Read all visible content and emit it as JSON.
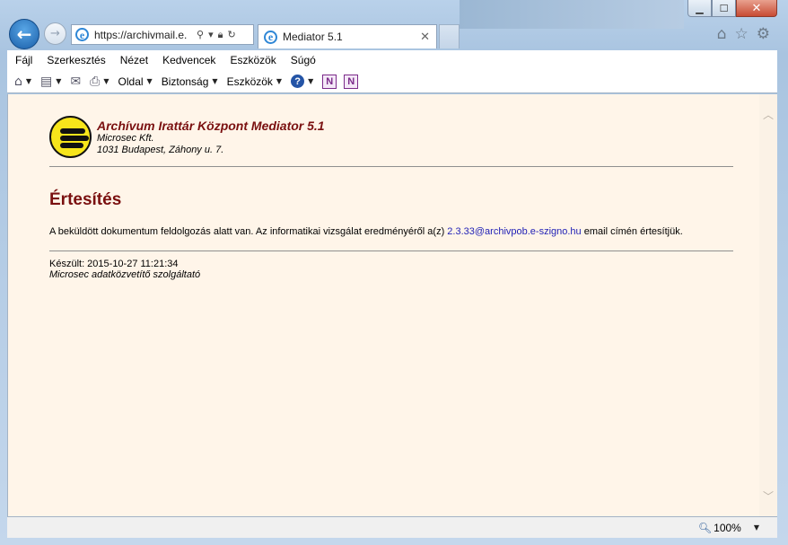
{
  "browser": {
    "url": "https://archivmail.e.",
    "tab_title": "Mediator 5.1",
    "window_buttons": {
      "minimize": "▁",
      "maximize": "☐",
      "close": "✕"
    },
    "icons": {
      "back": "back-arrow-icon",
      "forward": "forward-arrow-icon",
      "home": "home-icon",
      "favorites": "star-icon",
      "tools": "gear-icon"
    }
  },
  "menu": [
    "Fájl",
    "Szerkesztés",
    "Nézet",
    "Kedvencek",
    "Eszközök",
    "Súgó"
  ],
  "commandbar": {
    "page": "Oldal",
    "safety": "Biztonság",
    "tools": "Eszközök",
    "help_symbol": "?",
    "onenote_symbol": "N"
  },
  "page": {
    "app_title": "Archívum Irattár Központ Mediator 5.1",
    "company": "Microsec Kft.",
    "address": "1031 Budapest, Záhony u. 7.",
    "heading": "Értesítés",
    "message_before": "A beküldött dokumentum feldolgozás alatt van. Az informatikai vizsgálat eredményéről a(z) ",
    "email": "2.3.33@archivpob.e-szigno.hu",
    "message_after": " email címén értesítjük.",
    "created": "Készült: 2015-10-27 11:21:34",
    "provider": "Microsec adatközvetítő szolgáltató"
  },
  "status": {
    "zoom": "100%"
  }
}
